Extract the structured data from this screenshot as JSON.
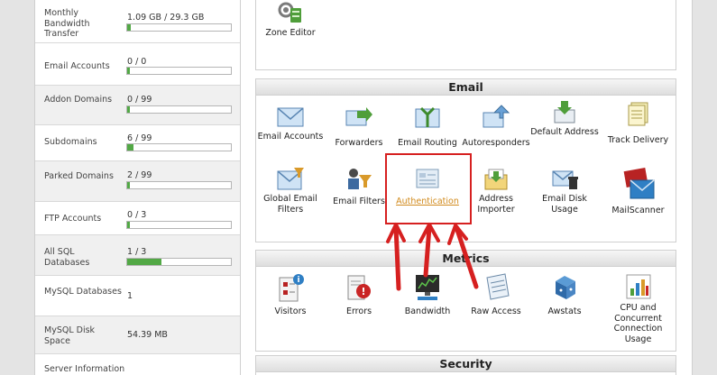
{
  "stats": [
    {
      "label": "Monthly Bandwidth Transfer",
      "value": "1.09 GB / 29.3 GB",
      "fraction": 0.037
    },
    {
      "label": "Email Accounts",
      "value": "0 / 0",
      "fraction": 0
    },
    {
      "label": "Addon Domains",
      "value": "0 / 99",
      "fraction": 0
    },
    {
      "label": "Subdomains",
      "value": "6 / 99",
      "fraction": 0.06
    },
    {
      "label": "Parked Domains",
      "value": "2 / 99",
      "fraction": 0.02
    },
    {
      "label": "FTP Accounts",
      "value": "0 / 3",
      "fraction": 0
    },
    {
      "label": "All SQL Databases",
      "value": "1 / 3",
      "fraction": 0.33
    },
    {
      "label": "MySQL Databases",
      "value": "1"
    },
    {
      "label": "MySQL Disk Space",
      "value": "54.39 MB"
    },
    {
      "label": "Server Information",
      "value": ""
    }
  ],
  "domains": {
    "apps": [
      {
        "label": "Zone Editor",
        "icon": "zone-editor-icon"
      }
    ]
  },
  "email": {
    "title": "Email",
    "apps": [
      {
        "label": "Email Accounts",
        "icon": "email-accounts-icon"
      },
      {
        "label": "Forwarders",
        "icon": "forwarders-icon"
      },
      {
        "label": "Email Routing",
        "icon": "email-routing-icon"
      },
      {
        "label": "Autoresponders",
        "icon": "autoresponders-icon"
      },
      {
        "label": "Default Address",
        "icon": "default-address-icon"
      },
      {
        "label": "Track Delivery",
        "icon": "track-delivery-icon"
      },
      {
        "label": "Global Email Filters",
        "icon": "global-email-filters-icon"
      },
      {
        "label": "Email Filters",
        "icon": "email-filters-icon"
      },
      {
        "label": "Authentication",
        "icon": "authentication-icon"
      },
      {
        "label": "Address Importer",
        "icon": "address-importer-icon"
      },
      {
        "label": "Email Disk Usage",
        "icon": "email-disk-usage-icon"
      },
      {
        "label": "MailScanner",
        "icon": "mailscanner-icon"
      }
    ]
  },
  "metrics": {
    "title": "Metrics",
    "apps": [
      {
        "label": "Visitors",
        "icon": "visitors-icon"
      },
      {
        "label": "Errors",
        "icon": "errors-icon"
      },
      {
        "label": "Bandwidth",
        "icon": "bandwidth-icon"
      },
      {
        "label": "Raw Access",
        "icon": "raw-access-icon"
      },
      {
        "label": "Awstats",
        "icon": "awstats-icon"
      },
      {
        "label": "CPU and Concurrent Connection Usage",
        "icon": "cpu-usage-icon"
      }
    ]
  },
  "security": {
    "title": "Security"
  },
  "colors": {
    "bar_fill": "#52a845",
    "highlight": "#d62020",
    "active_link": "#d18a1c"
  }
}
